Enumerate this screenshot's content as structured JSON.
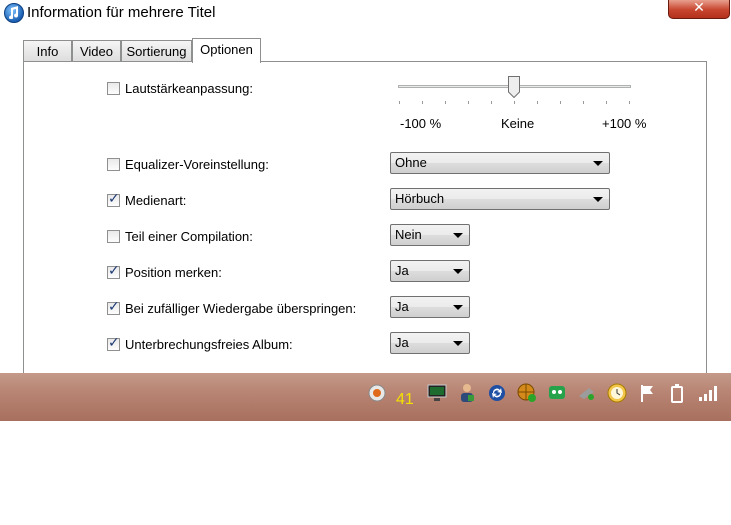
{
  "window": {
    "title": "Information für mehrere Titel",
    "close_label": "✕"
  },
  "tabs": [
    {
      "label": "Info",
      "active": false
    },
    {
      "label": "Video",
      "active": false
    },
    {
      "label": "Sortierung",
      "active": false
    },
    {
      "label": "Optionen",
      "active": true
    }
  ],
  "volume": {
    "label": "Lautstärkeanpassung:",
    "checked": false,
    "min_label": "-100 %",
    "mid_label": "Keine",
    "max_label": "+100 %",
    "value_percent": 0
  },
  "options": [
    {
      "label": "Equalizer-Voreinstellung:",
      "checked": false,
      "value": "Ohne"
    },
    {
      "label": "Medienart:",
      "checked": true,
      "value": "Hörbuch"
    },
    {
      "label": "Teil einer Compilation:",
      "checked": false,
      "value": "Nein"
    },
    {
      "label": "Position merken:",
      "checked": true,
      "value": "Ja"
    },
    {
      "label": "Bei zufälliger Wiedergabe überspringen:",
      "checked": true,
      "value": "Ja"
    },
    {
      "label": "Unterbrechungsfreies Album:",
      "checked": true,
      "value": "Ja"
    }
  ],
  "taskbar": {
    "tray_count": "41",
    "icons": [
      "browser-icon",
      "monitor-icon",
      "user-icon",
      "sync-icon",
      "network-globe-icon",
      "robot-icon",
      "satellite-icon",
      "clock-icon",
      "flag-icon",
      "power-icon",
      "signal-icon"
    ]
  }
}
